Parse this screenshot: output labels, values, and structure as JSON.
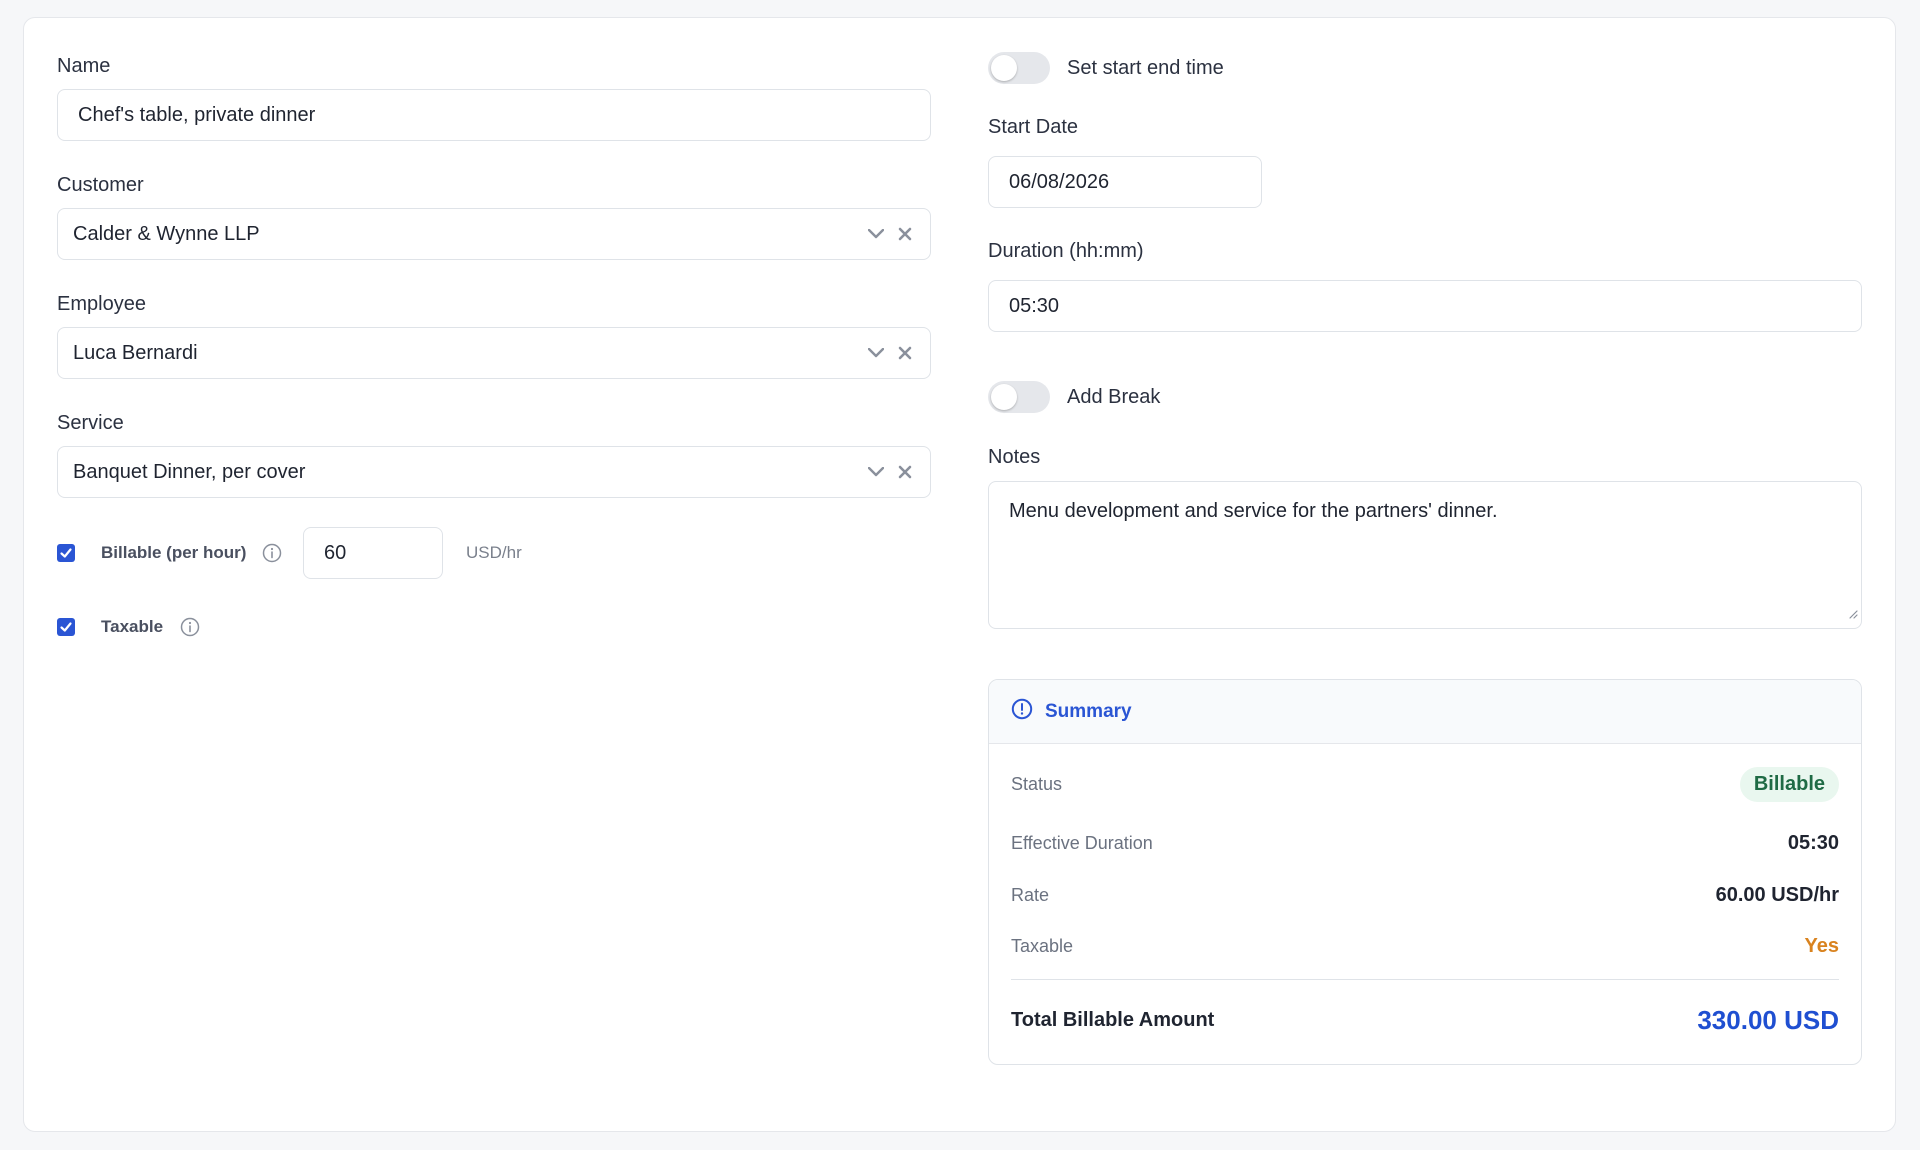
{
  "form": {
    "name": {
      "label": "Name",
      "value": "Chef's table, private dinner"
    },
    "customer": {
      "label": "Customer",
      "value": "Calder & Wynne LLP"
    },
    "employee": {
      "label": "Employee",
      "value": "Luca Bernardi"
    },
    "service": {
      "label": "Service",
      "value": "Banquet Dinner, per cover"
    },
    "billable": {
      "label": "Billable (per hour)",
      "checked": true,
      "rate": "60",
      "unit": "USD/hr"
    },
    "taxable": {
      "label": "Taxable",
      "checked": true
    }
  },
  "schedule": {
    "set_start_end_time": {
      "label": "Set start end time",
      "on": false
    },
    "start_date": {
      "label": "Start Date",
      "value": "06/08/2026"
    },
    "duration": {
      "label": "Duration (hh:mm)",
      "value": "05:30"
    },
    "add_break": {
      "label": "Add Break",
      "on": false
    },
    "notes": {
      "label": "Notes",
      "value": "Menu development and service for the partners' dinner."
    }
  },
  "summary": {
    "title": "Summary",
    "status_label": "Status",
    "status_value": "Billable",
    "effective_duration_label": "Effective Duration",
    "effective_duration_value": "05:30",
    "rate_label": "Rate",
    "rate_value": "60.00 USD/hr",
    "taxable_label": "Taxable",
    "taxable_value": "Yes",
    "total_label": "Total Billable Amount",
    "total_value": "330.00 USD"
  },
  "colors": {
    "accent": "#2a55d4",
    "billable_badge_bg": "#e9f7ef",
    "billable_badge_text": "#1f6b45",
    "taxable_yes": "#d9831f",
    "total": "#1f4fd1"
  },
  "icons": {
    "select_open": "chevron-down-icon",
    "select_clear": "close-icon",
    "info": "info-icon",
    "summary": "alert-circle-icon",
    "checkbox": "check-icon"
  }
}
